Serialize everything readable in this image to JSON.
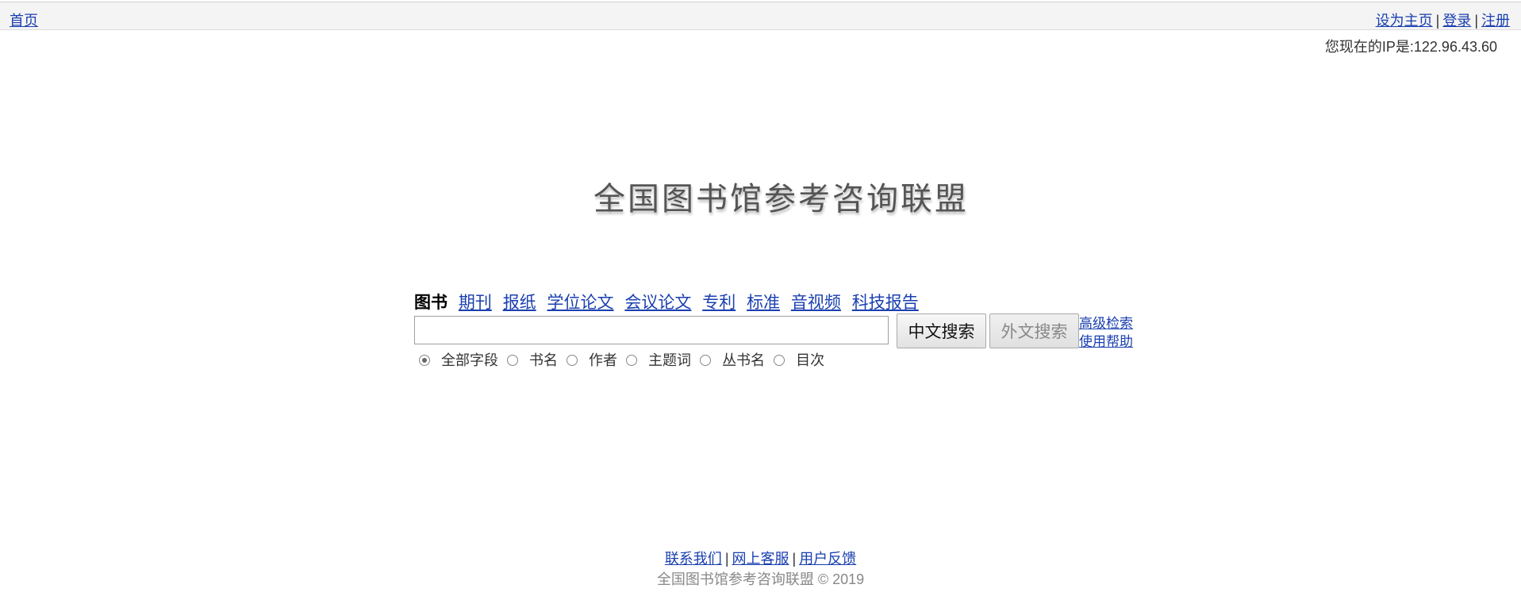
{
  "topbar": {
    "home": "首页",
    "set_home": "设为主页",
    "login": "登录",
    "register": "注册",
    "separator": "|"
  },
  "ip_text": "您现在的IP是:122.96.43.60",
  "logo_text": "全国图书馆参考咨询联盟",
  "tabs": [
    {
      "label": "图书",
      "active": true
    },
    {
      "label": "期刊"
    },
    {
      "label": "报纸"
    },
    {
      "label": "学位论文"
    },
    {
      "label": "会议论文"
    },
    {
      "label": "专利"
    },
    {
      "label": "标准"
    },
    {
      "label": "音视频"
    },
    {
      "label": "科技报告"
    }
  ],
  "search": {
    "value": "",
    "placeholder": "",
    "chinese_button": "中文搜索",
    "foreign_button": "外文搜索"
  },
  "side_links": {
    "advanced": "高级检索",
    "help": "使用帮助"
  },
  "radios": {
    "selected": "全部字段",
    "options": [
      "全部字段",
      "书名",
      "作者",
      "主题词",
      "丛书名",
      "目次"
    ]
  },
  "footer": {
    "contact": "联系我们",
    "online_service": "网上客服",
    "feedback": "用户反馈",
    "separator": "|",
    "copyright": "全国图书馆参考咨询联盟 © 2019"
  }
}
